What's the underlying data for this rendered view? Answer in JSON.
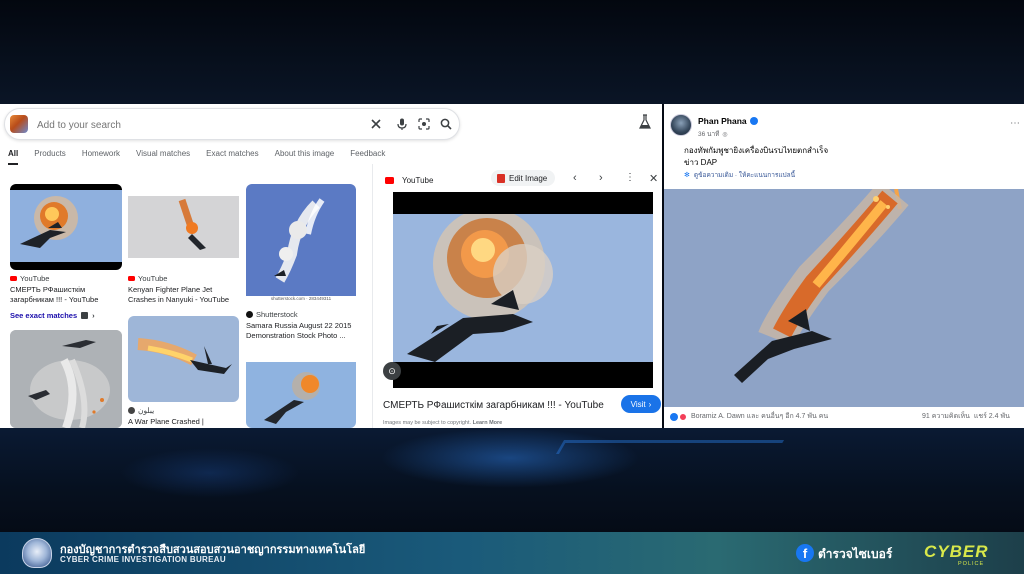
{
  "google": {
    "search": {
      "placeholder": "Add to your search"
    },
    "tabs": [
      "All",
      "Products",
      "Homework",
      "Visual matches",
      "Exact matches",
      "About this image",
      "Feedback"
    ],
    "results": [
      {
        "source": "YouTube",
        "caption": "СМЕРТЬ РФашисткім загарбникам !!! - YouTube",
        "icon": "youtube-icon"
      },
      {
        "source": "YouTube",
        "caption": "Kenyan Fighter Plane Jet Crashes in Nanyuki - YouTube",
        "icon": "youtube-icon"
      },
      {
        "source": "Shutterstock",
        "caption": "Samara Russia August 22 2015 Demonstration Stock Photo ...",
        "icon": "shutterstock-icon",
        "watermark": "shutterstock.com · 283449311"
      },
      {
        "source": "يبلون",
        "caption": "A War Plane Crashed |",
        "icon": "site-icon"
      }
    ],
    "see_exact_matches": "See exact matches",
    "preview": {
      "source": "YouTube",
      "edit_label": "Edit Image",
      "title": "СМЕРТЬ РФашисткім загарбникам !!! - YouTube",
      "visit_label": "Visit",
      "copyright_note": "Images may be subject to copyright.",
      "learn_more": "Learn More"
    }
  },
  "facebook": {
    "author": "Phan Phana",
    "time": "36 นาที",
    "text_line1": "กองทัพกัมพูชายิงเครื่องบินรบไทยตกสำเร็จ",
    "text_line2": "ข่าว DAP",
    "translate": "ดูข้อความเดิม · ให้คะแนนการแปลนี้",
    "reactions": "Boramiz A. Dawn และ คนอื่นๆ อีก 4.7 พัน คน",
    "comments": "91 ความคิดเห็น",
    "shares": "แชร์ 2.4 พัน"
  },
  "footer": {
    "org_th": "กองบัญชาการตำรวจสืบสวนสอบสวนอาชญากรรมทางเทคโนโลยี",
    "org_en": "CYBER CRIME INVESTIGATION BUREAU",
    "page_name": "ตำรวจไซเบอร์",
    "brand": "CYBER",
    "brand_sub": "POLICE"
  },
  "colors": {
    "google_link": "#1a0dab",
    "visit_button": "#1a73e8",
    "facebook_blue": "#1877f2",
    "footer_accent": "#d8e84a"
  }
}
